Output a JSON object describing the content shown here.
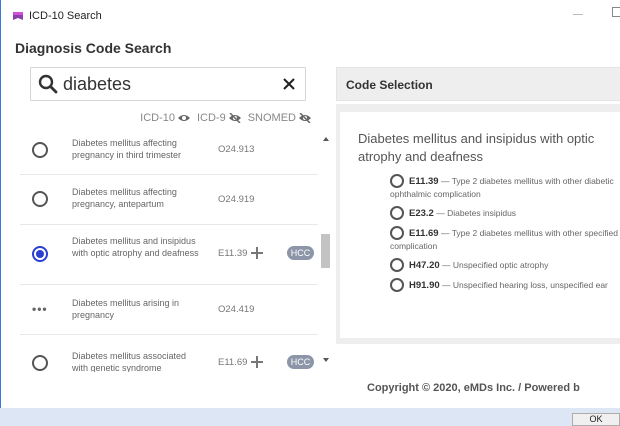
{
  "window": {
    "title": "ICD-10 Search"
  },
  "page": {
    "title": "Diagnosis Code Search"
  },
  "search": {
    "value": "diabetes"
  },
  "code_systems": [
    {
      "label": "ICD-10",
      "icon": "eye-icon",
      "visible": true
    },
    {
      "label": "ICD-9",
      "icon": "eye-slash-icon",
      "visible": false
    },
    {
      "label": "SNOMED",
      "icon": "eye-slash-icon",
      "visible": false
    }
  ],
  "results": [
    {
      "description": "Diabetes mellitus affecting pregnancy in third trimester",
      "code": "O24.913",
      "has_children": false,
      "hcc": "",
      "marker": "radio",
      "selected": false
    },
    {
      "description": "Diabetes mellitus affecting pregnancy, antepartum",
      "code": "O24.919",
      "has_children": false,
      "hcc": "",
      "marker": "radio",
      "selected": false
    },
    {
      "description": "Diabetes mellitus and insipidus with optic atrophy and deafness",
      "code": "E11.39",
      "has_children": true,
      "hcc": "HCC",
      "marker": "radio",
      "selected": true
    },
    {
      "description": "Diabetes mellitus arising in pregnancy",
      "code": "O24.419",
      "has_children": false,
      "hcc": "",
      "marker": "dots",
      "selected": false
    },
    {
      "description": "Diabetes mellitus associated with genetic syndrome",
      "code": "E11.69",
      "has_children": true,
      "hcc": "HCC",
      "marker": "radio",
      "selected": false
    }
  ],
  "code_selection": {
    "header": "Code Selection",
    "title": "Diabetes mellitus and insipidus with optic atrophy and deafness",
    "dash": "—",
    "options": [
      {
        "code": "E11.39",
        "description": "Type 2 diabetes mellitus with other diabetic ophthalmic complication"
      },
      {
        "code": "E23.2",
        "description": "Diabetes insipidus"
      },
      {
        "code": "E11.69",
        "description": "Type 2 diabetes mellitus with other specified complication"
      },
      {
        "code": "H47.20",
        "description": "Unspecified optic atrophy"
      },
      {
        "code": "H91.90",
        "description": "Unspecified hearing loss, unspecified ear"
      }
    ]
  },
  "footer": {
    "copyright": "Copyright © 2020, eMDs Inc. / Powered b"
  },
  "buttons": {
    "ok": "OK"
  },
  "colors": {
    "selected_radio": "#2b3fd1",
    "hcc_badge": "#8c96a8",
    "panel_bg": "#eeeeee",
    "bottom_bar": "#dce6f4"
  }
}
